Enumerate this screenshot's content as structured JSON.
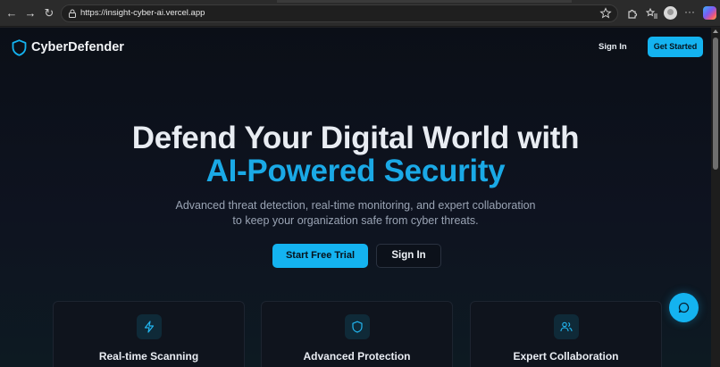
{
  "browser": {
    "url": "https://insight-cyber-ai.vercel.app",
    "menu_dots": "···"
  },
  "site": {
    "brand": "CyberDefender",
    "nav": {
      "sign_in": "Sign In",
      "get_started": "Get Started"
    },
    "hero": {
      "title_line1": "Defend Your Digital World with",
      "title_line2": "AI-Powered Security",
      "subtitle_line1": "Advanced threat detection, real-time monitoring, and expert collaboration",
      "subtitle_line2": "to keep your organization safe from cyber threats.",
      "primary_cta": "Start Free Trial",
      "secondary_cta": "Sign In"
    },
    "features": [
      {
        "title": "Real-time Scanning",
        "icon": "lightning-icon"
      },
      {
        "title": "Advanced Protection",
        "icon": "shield-icon"
      },
      {
        "title": "Expert Collaboration",
        "icon": "users-icon"
      }
    ]
  },
  "colors": {
    "accent": "#14b3f0",
    "headline_accent": "#1aa9e6",
    "background": "#0b0f17"
  }
}
